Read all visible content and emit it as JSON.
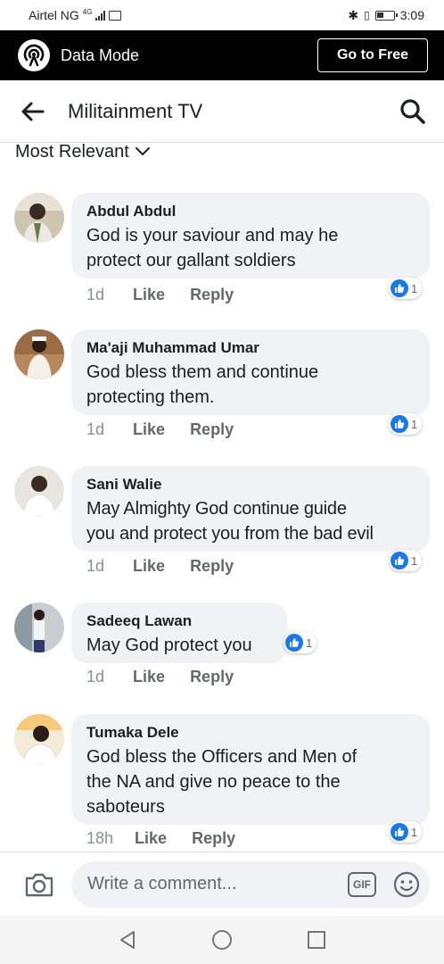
{
  "status_bar": {
    "carrier": "Airtel NG",
    "net_type": "4G",
    "time": "3:09"
  },
  "data_mode": {
    "label": "Data Mode",
    "button": "Go to Free"
  },
  "header": {
    "title": "Militainment TV",
    "back_icon": "arrow-left-icon",
    "search_icon": "search-icon"
  },
  "sort": {
    "label": "Most Relevant",
    "icon": "chevron-down-icon"
  },
  "comments": [
    {
      "name": "Abdul Abdul",
      "lines": [
        "God is your saviour and may he",
        "protect our gallant soldiers"
      ],
      "time": "1d",
      "like": "Like",
      "reply": "Reply",
      "reactions": "1"
    },
    {
      "name": "Ma'aji Muhammad Umar",
      "lines": [
        "God bless them and continue",
        "protecting them."
      ],
      "time": "1d",
      "like": "Like",
      "reply": "Reply",
      "reactions": "1"
    },
    {
      "name": "Sani Walie",
      "lines": [
        "May Almighty God continue guide",
        "you and protect you from the bad evil"
      ],
      "time": "1d",
      "like": "Like",
      "reply": "Reply",
      "reactions": "1"
    },
    {
      "name": "Sadeeq Lawan",
      "lines": [
        "May God protect you"
      ],
      "time": "1d",
      "like": "Like",
      "reply": "Reply",
      "reactions": "1"
    },
    {
      "name": "Tumaka Dele",
      "lines": [
        "God bless the Officers and Men of",
        "the NA and give no peace to the",
        "saboteurs"
      ],
      "time": "18h",
      "like": "Like",
      "reply": "Reply",
      "reactions": "1"
    }
  ],
  "composer": {
    "placeholder": "Write a comment...",
    "gif_label": "GIF"
  },
  "colors": {
    "accent": "#1877f2",
    "bubble": "#f0f2f5",
    "data_mode_bg": "#000000"
  }
}
